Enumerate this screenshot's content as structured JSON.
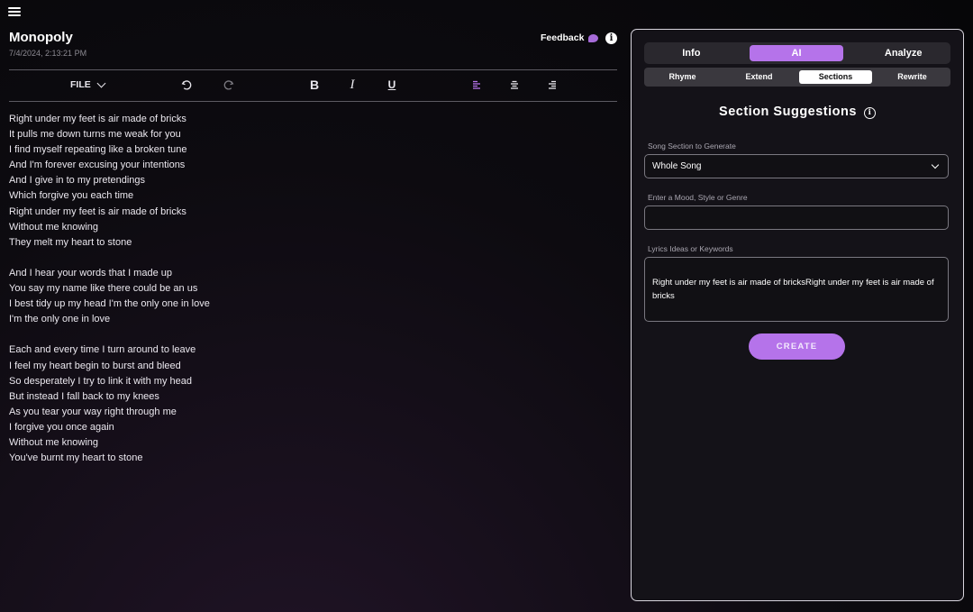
{
  "header": {
    "title": "Monopoly",
    "date": "7/4/2024, 2:13:21 PM",
    "feedback_label": "Feedback",
    "info_icon": "info-icon"
  },
  "toolbar": {
    "file_label": "FILE",
    "icons": [
      "undo-icon",
      "redo-icon",
      "bold-icon",
      "italic-icon",
      "underline-icon",
      "align-left-icon",
      "align-center-icon",
      "align-right-icon"
    ]
  },
  "lyrics": [
    [
      "Right under my feet is air made of bricks",
      "It pulls me down turns me weak for you",
      "I find myself repeating like a broken tune",
      "And I'm forever excusing your intentions",
      "And I give in to my pretendings",
      "Which forgive you each time",
      "Right under my feet is air made of bricks",
      "Without me knowing",
      "They melt my heart to stone"
    ],
    [
      "And I hear your words that I made up",
      "You say my name like there could be an us",
      "I best tidy up my head I'm the only one in love",
      "I'm the only one in love"
    ],
    [
      "Each and every time I turn around to leave",
      "I feel my heart begin to burst and bleed",
      "So desperately I try to link it with my head",
      "But instead I fall back to my knees",
      "As you tear your way right through me",
      "I forgive you once again",
      "Without me knowing",
      "You've burnt my heart to stone"
    ]
  ],
  "panel": {
    "tabs": [
      "Info",
      "AI",
      "Analyze"
    ],
    "active_tab": "AI",
    "subtabs": [
      "Rhyme",
      "Extend",
      "Sections",
      "Rewrite"
    ],
    "active_subtab": "Sections",
    "section_title": "Section Suggestions",
    "section_label": "Song Section to Generate",
    "section_value": "Whole Song",
    "mood_label": "Enter a Mood, Style or Genre",
    "mood_value": "",
    "ideas_label": "Lyrics Ideas or Keywords",
    "ideas_value": "Right under my feet is air made of bricksRight under my feet is air made of bricks",
    "create_label": "CREATE"
  },
  "colors": {
    "accent": "#b573ea",
    "background": "#0d0b10",
    "panel_border": "#d8d5de"
  }
}
